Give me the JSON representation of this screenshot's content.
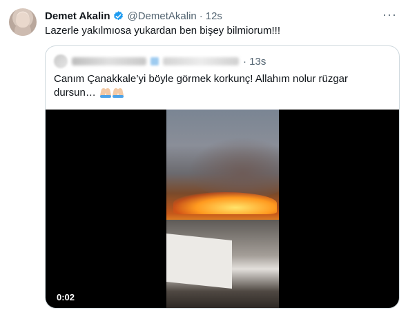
{
  "tweet": {
    "author": {
      "display_name": "Demet Akalin",
      "handle": "@DemetAkalin",
      "verified": true
    },
    "separator": "·",
    "time": "12s",
    "text": "Lazerle yakılmıosa yukardan ben bişey bilmiorum!!!",
    "more_icon": "more-icon"
  },
  "quoted": {
    "time": "13s",
    "text": "Canım Çanakkale’yi böyle görmek korkunç! Allahım nolur rüzgar dursun…",
    "emojis": [
      "folded-hands",
      "folded-hands"
    ],
    "video": {
      "timecode": "0:02"
    }
  },
  "colors": {
    "verified": "#1d9bf0",
    "secondary_text": "#536471",
    "border": "#cfd9de"
  }
}
